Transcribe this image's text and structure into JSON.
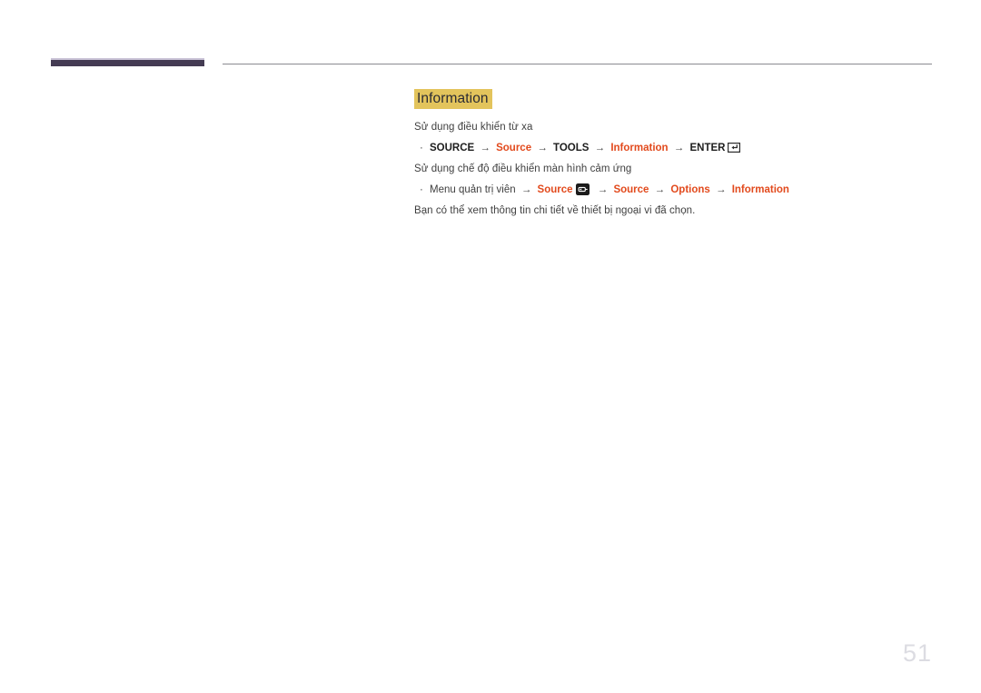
{
  "document": {
    "page_number": "51",
    "header": {
      "accent_bar_color": "#443b53",
      "rule_color": "#8b8b90"
    }
  },
  "section": {
    "heading": "Information",
    "heading_highlight_color": "#e3c45c",
    "accent_color": "#e24a1d",
    "intro_remote": "Sử dụng điều khiển từ xa",
    "intro_touch": "Sử dụng chế độ điều khiển màn hình cảm ứng",
    "description": "Bạn có thể xem thông tin chi tiết về thiết bị ngoại vi đã chọn.",
    "bullets": [
      {
        "marker": "·",
        "tokens": [
          {
            "text": "SOURCE",
            "style": "bold"
          },
          {
            "text": "→",
            "style": "arrow"
          },
          {
            "text": "Source",
            "style": "accent"
          },
          {
            "text": "→",
            "style": "arrow"
          },
          {
            "text": "TOOLS",
            "style": "bold"
          },
          {
            "text": "→",
            "style": "arrow"
          },
          {
            "text": "Information",
            "style": "accent"
          },
          {
            "text": "→",
            "style": "arrow"
          },
          {
            "text": "ENTER",
            "style": "bold"
          },
          {
            "text": "enter-key-icon",
            "style": "icon-enter"
          }
        ]
      },
      {
        "marker": "·",
        "tokens": [
          {
            "text": "Menu quản trị viên",
            "style": "plain"
          },
          {
            "text": "→",
            "style": "arrow"
          },
          {
            "text": "Source",
            "style": "accent"
          },
          {
            "text": "source-badge-icon",
            "style": "icon-source"
          },
          {
            "text": "→",
            "style": "arrow"
          },
          {
            "text": "Source",
            "style": "accent"
          },
          {
            "text": "→",
            "style": "arrow"
          },
          {
            "text": "Options",
            "style": "accent"
          },
          {
            "text": "→",
            "style": "arrow"
          },
          {
            "text": "Information",
            "style": "accent"
          }
        ]
      }
    ]
  }
}
